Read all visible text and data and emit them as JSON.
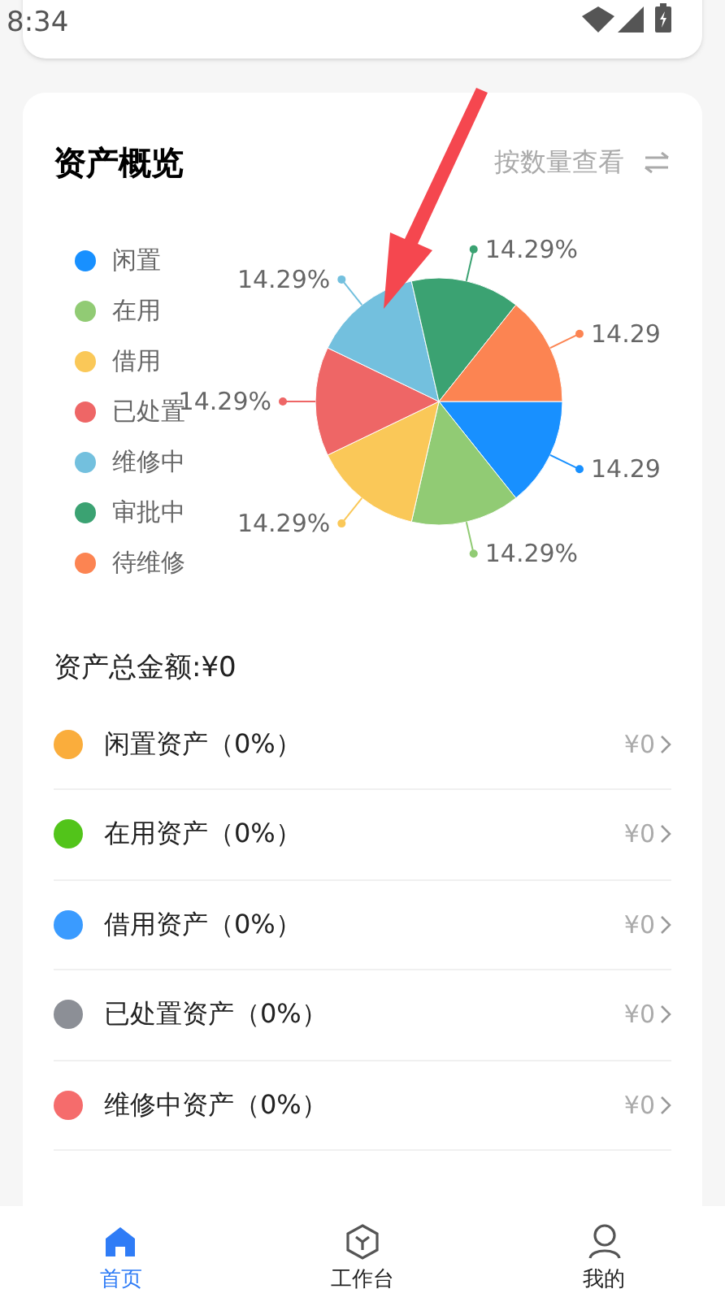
{
  "status_bar": {
    "time": "8:34"
  },
  "overview": {
    "title": "资产概览",
    "view_toggle": "按数量查看",
    "chart_data": {
      "type": "pie",
      "categories": [
        "闲置",
        "在用",
        "借用",
        "已处置",
        "维修中",
        "审批中",
        "待维修"
      ],
      "values": [
        14.29,
        14.29,
        14.29,
        14.29,
        14.29,
        14.29,
        14.29
      ],
      "value_labels": [
        "14.29",
        "14.29%",
        "14.29%",
        "14.29%",
        "14.29%",
        "14.29%",
        "14.29"
      ],
      "legend": "left"
    },
    "slices": [
      {
        "color": "#1890ff"
      },
      {
        "color": "#91cb74"
      },
      {
        "color": "#fac858"
      },
      {
        "color": "#ee6666"
      },
      {
        "color": "#73c0de"
      },
      {
        "color": "#3ba272"
      },
      {
        "color": "#fc8452"
      }
    ]
  },
  "total": "资产总金额:¥0",
  "asset_rows": [
    {
      "label": "闲置资产（0%）",
      "amount": "¥0",
      "color": "#faad3c"
    },
    {
      "label": "在用资产（0%）",
      "amount": "¥0",
      "color": "#52c41a"
    },
    {
      "label": "借用资产（0%）",
      "amount": "¥0",
      "color": "#3a9bff"
    },
    {
      "label": "已处置资产（0%）",
      "amount": "¥0",
      "color": "#8c8f96"
    },
    {
      "label": "维修中资产（0%）",
      "amount": "¥0",
      "color": "#f56c6c"
    }
  ],
  "nav": [
    {
      "kind": "home",
      "label": "首页",
      "selected": true
    },
    {
      "kind": "workbench",
      "label": "工作台",
      "selected": false
    },
    {
      "kind": "profile",
      "label": "我的",
      "selected": false
    }
  ]
}
